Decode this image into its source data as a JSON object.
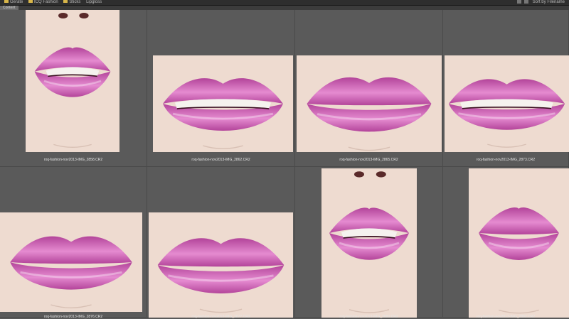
{
  "window": {
    "breadcrumbs": [
      "Geräte",
      "ICQ Fashion",
      "Sticks",
      "Lipgloss"
    ],
    "sort_label": "Sort by Filename"
  },
  "panel_tab": "Content",
  "colors": {
    "lipstick": "#b3449a",
    "lipstick_light": "#e58bd0",
    "skin": "#eedbd0"
  },
  "thumbnails": [
    {
      "filename": "roq-fashion-nov2013-IMG_2858.CR2",
      "orientation": "portrait"
    },
    {
      "filename": "roq-fashion-nov2013-IMG_2862.CR2",
      "orientation": "landscape"
    },
    {
      "filename": "roq-fashion-nov2013-IMG_2865.CR2",
      "orientation": "landscape"
    },
    {
      "filename": "roq-fashion-nov2013-IMG_2873.CR2",
      "orientation": "landscape"
    },
    {
      "filename": "roq-fashion-nov2013-IMG_2876.CR2",
      "orientation": "landscape"
    },
    {
      "filename": "roq-fashion-nov2013-IMG_2877.CR2",
      "orientation": "landscape"
    },
    {
      "filename": "roq-fashion-nov2013-IMG_2880.CR2",
      "orientation": "portrait"
    },
    {
      "filename": "roq-fashion-nov2013-IMG_2882.CR2",
      "orientation": "portrait"
    }
  ]
}
